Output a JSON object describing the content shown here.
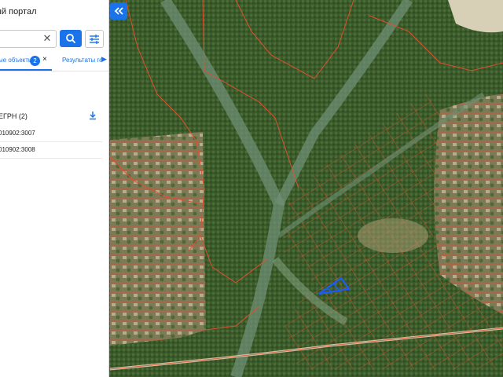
{
  "portal": {
    "title": "ый портал"
  },
  "search": {
    "clear_icon": "close-icon",
    "search_icon": "search-icon",
    "filter_icon": "filter-icon"
  },
  "tabs": {
    "active": {
      "label": "ые объекты",
      "badge": "2",
      "close": "×"
    },
    "second": {
      "label": "Результаты ге"
    }
  },
  "results": {
    "section_title": "ЕГРН (2)",
    "download_icon": "download-icon",
    "items": [
      {
        "label": "010902:3007"
      },
      {
        "label": "010902:3008"
      }
    ]
  },
  "map": {
    "collapse_icon": "double-chevron-left-icon",
    "highlight_color": "#1a5cff",
    "parcel_color": "#e0502e",
    "accent_color": "#1a73e8"
  }
}
